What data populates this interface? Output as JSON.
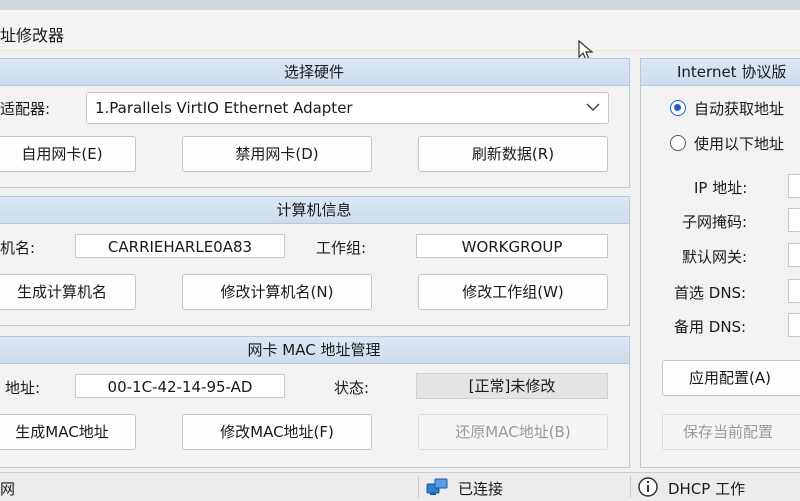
{
  "window": {
    "title": "址修改器"
  },
  "hardware": {
    "header": "选择硬件",
    "adapter_label": "适配器:",
    "adapter_value": "1.Parallels VirtIO Ethernet Adapter",
    "btn_enable": "自用网卡(E)",
    "btn_disable": "禁用网卡(D)",
    "btn_refresh": "刷新数据(R)"
  },
  "computer": {
    "header": "计算机信息",
    "name_label": "机名:",
    "name_value": "CARRIEHARLE0A83",
    "workgroup_label": "工作组:",
    "workgroup_value": "WORKGROUP",
    "btn_gen_name": "生成计算机名",
    "btn_change_name": "修改计算机名(N)",
    "btn_change_workgroup": "修改工作组(W)"
  },
  "mac": {
    "header": "网卡 MAC 地址管理",
    "address_label": "地址:",
    "address_value": "00-1C-42-14-95-AD",
    "status_label": "状态:",
    "status_value": "[正常]未修改",
    "btn_gen_mac": "生成MAC地址",
    "btn_change_mac": "修改MAC地址(F)",
    "btn_restore_mac": "还原MAC地址(B)"
  },
  "ip": {
    "header": "Internet 协议版",
    "radio_auto": "自动获取地址",
    "radio_manual": "使用以下地址",
    "ip_label": "IP 地址:",
    "subnet_label": "子网掩码:",
    "gateway_label": "默认网关:",
    "dns1_label": "首选 DNS:",
    "dns2_label": "备用 DNS:",
    "btn_apply": "应用配置(A)",
    "btn_save": "保存当前配置"
  },
  "statusbar": {
    "left": "网",
    "connection": "已连接",
    "dhcp": "DHCP 工作"
  },
  "colors": {
    "accent": "#1c5fd0",
    "header_bg": "#d4e2f0",
    "border": "#b8c8d8"
  }
}
